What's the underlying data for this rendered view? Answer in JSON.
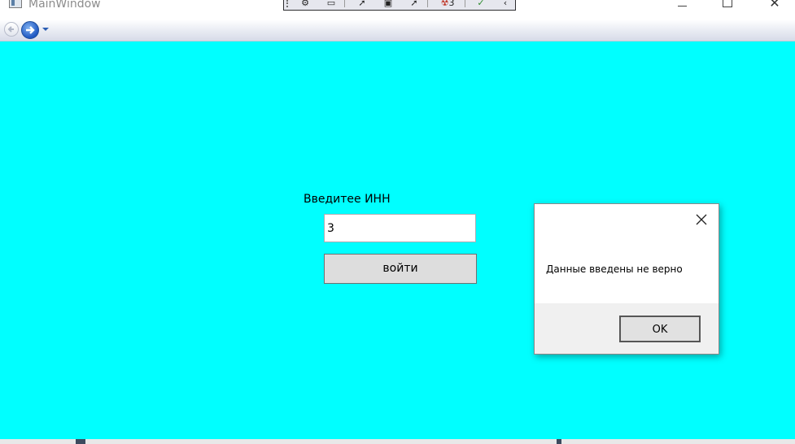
{
  "window": {
    "title": "MainWindow",
    "caption_buttons": {
      "minimize": "—",
      "maximize": "",
      "close": "✕"
    }
  },
  "debug_toolbar": {
    "badge": "3"
  },
  "form": {
    "inn_label": "Введитее ИНН",
    "inn_value": "3",
    "login_button": "войти"
  },
  "message_box": {
    "text": "Данные введены не верно",
    "ok_button": "OK"
  },
  "colors": {
    "content_background": "#00ffff",
    "button_background": "#dddddd"
  }
}
